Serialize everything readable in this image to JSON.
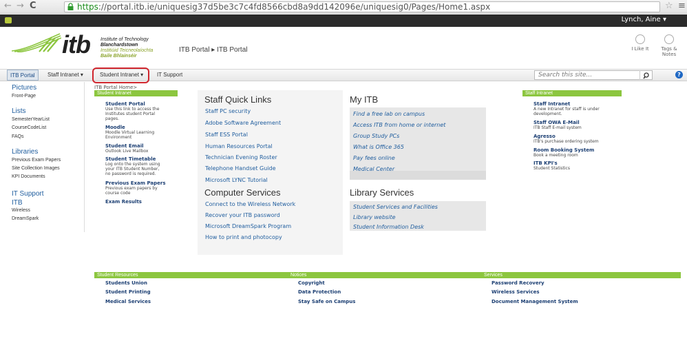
{
  "browser": {
    "url_scheme": "https",
    "url_rest": "://portal.itb.ie/uniquesig37d5be3c7c4fd8566cbd8a9dd142096e/uniquesig0/Pages/Home1.aspx",
    "back": "←",
    "forward": "→",
    "reload": "C",
    "star": "☆",
    "menu": "≡"
  },
  "sp": {
    "user": "Lynch, Aine ▾"
  },
  "header": {
    "logo_text": "itb",
    "inst_line1": "Institute of Technology",
    "inst_line2": "Blanchardstown",
    "inst_line3": "Institiúid Teicneolaíochta",
    "inst_line4": "Baile Bhlainséir",
    "breadcrumb": "ITB Portal ▸ ITB Portal",
    "i_like_it": "I Like It",
    "tags_notes": "Tags & Notes"
  },
  "nav": {
    "tabs": [
      "ITB Portal",
      "Staff Intranet ▾",
      "Student Intranet ▾",
      "IT Support"
    ],
    "search_placeholder": "Search this site..."
  },
  "quicklaunch": {
    "pictures": "Pictures",
    "front_page": "Front-Page",
    "lists": "Lists",
    "semester": "SemesterYearList",
    "coursecode": "CourseCodeList",
    "faqs": "FAQs",
    "libraries": "Libraries",
    "prev_exam": "Previous Exam Papers",
    "site_coll": "Site Collection Images",
    "kpi_docs": "KPI Documents",
    "it_support": "IT Support",
    "itb": "ITB",
    "wireless": "Wireless",
    "dreamspark": "DreamSpark"
  },
  "student": {
    "bc": "ITB Portal Home>",
    "header": "Student Intranet",
    "items": [
      {
        "title": "Student Portal",
        "desc1": "Use this link to access the",
        "desc2": "Institutes student Portal",
        "desc3": "pages."
      },
      {
        "title": "Moodle",
        "desc1": "Moodle Virtual Learning",
        "desc2": "Environment",
        "desc3": ""
      },
      {
        "title": "Student Email",
        "desc1": "Outlook Live Mailbox",
        "desc2": "",
        "desc3": ""
      },
      {
        "title": "Student Timetable",
        "desc1": "Log onto the system using",
        "desc2": "your ITB Student Number,",
        "desc3": "no password is required."
      },
      {
        "title": "Previous Exam Papers",
        "desc1": "Previous exam papers by",
        "desc2": "course code",
        "desc3": ""
      },
      {
        "title": "Exam Results",
        "desc1": "",
        "desc2": "",
        "desc3": ""
      }
    ]
  },
  "staff_quick": {
    "title": "Staff Quick Links",
    "links": [
      "Staff PC security",
      "Adobe Software Agreement",
      "Staff ESS Portal",
      "Human Resources Portal",
      "Technician Evening Roster",
      "Telephone Handset Guide",
      "Microsoft LYNC Tutorial"
    ]
  },
  "computer_services": {
    "title": "Computer Services",
    "links": [
      "Connect to the Wireless Network",
      "Recover your ITB password",
      "Microsoft DreamSpark Program",
      "How to print and photocopy"
    ]
  },
  "my_itb": {
    "title": "My ITB",
    "links": [
      "Find a free lab on campus",
      "Access ITB from home or internet",
      "Group Study PCs",
      "What is Office 365",
      "Pay fees online",
      "Medical Center"
    ]
  },
  "library": {
    "title": "Library Services",
    "links": [
      "Student Services and Facilities",
      "Library website",
      "Student Information Desk"
    ]
  },
  "staff_intranet": {
    "header": "Staff Intranet",
    "items": [
      {
        "title": "Staff Intranet",
        "desc1": "A new Intranet for staff is under",
        "desc2": "development."
      },
      {
        "title": "Staff OWA E-Mail",
        "desc1": "ITB Staff E-mail system",
        "desc2": ""
      },
      {
        "title": "Agresso",
        "desc1": "ITB's purchase ordering system",
        "desc2": ""
      },
      {
        "title": "Room Booking System",
        "desc1": "Book a meeting room",
        "desc2": ""
      },
      {
        "title": "ITB KPI's",
        "desc1": "Student Statistics",
        "desc2": ""
      }
    ]
  },
  "footer": {
    "h1": "Student Resources",
    "h2": "Notices",
    "h3": "Services",
    "col1": [
      "Students Union",
      "Student Printing",
      "Medical Services"
    ],
    "col2": [
      "Copyright",
      "Data Protection",
      "Stay Safe on Campus"
    ],
    "col3": [
      "Password Recovery",
      "Wireless Services",
      "Document Management System"
    ]
  },
  "colors": {
    "green": "#8cc63f",
    "link_blue": "#1f5d9e",
    "dark_blue": "#1c3f73",
    "highlight_red": "#d0262e"
  }
}
